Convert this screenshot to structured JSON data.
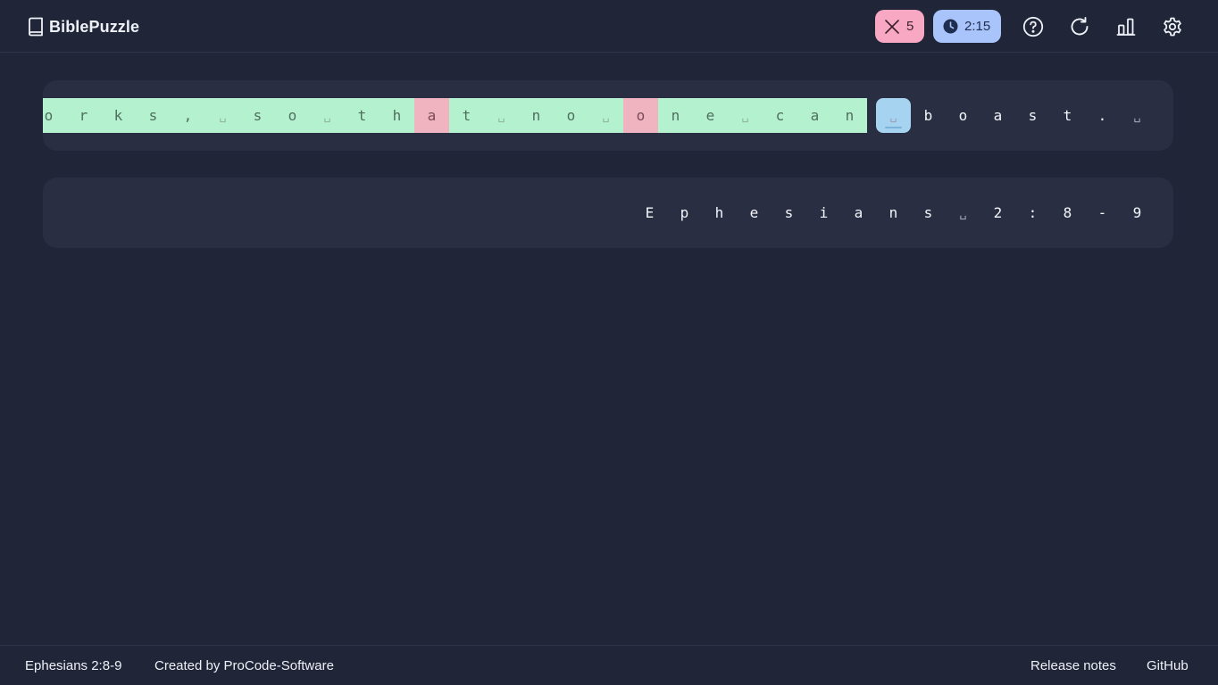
{
  "header": {
    "brand_name": "BiblePuzzle",
    "logo_icon": "book-icon",
    "mistakes": {
      "icon": "close-icon",
      "count": "5",
      "color": "#f9a8c3"
    },
    "timer": {
      "icon": "clock-icon",
      "time": "2:15",
      "color": "#a9c4fb"
    },
    "actions": [
      "help-icon",
      "restart-icon",
      "stats-icon",
      "settings-icon"
    ]
  },
  "verse": {
    "visible_text": "orks, so that no one can boast. ",
    "space_glyph": "␣",
    "chars": [
      {
        "c": "o",
        "state": "correct"
      },
      {
        "c": "r",
        "state": "correct"
      },
      {
        "c": "k",
        "state": "correct"
      },
      {
        "c": "s",
        "state": "correct"
      },
      {
        "c": ",",
        "state": "correct"
      },
      {
        "c": "␣",
        "state": "correct"
      },
      {
        "c": "s",
        "state": "correct"
      },
      {
        "c": "o",
        "state": "correct"
      },
      {
        "c": "␣",
        "state": "correct"
      },
      {
        "c": "t",
        "state": "correct"
      },
      {
        "c": "h",
        "state": "correct"
      },
      {
        "c": "a",
        "state": "wrong"
      },
      {
        "c": "t",
        "state": "correct"
      },
      {
        "c": "␣",
        "state": "correct"
      },
      {
        "c": "n",
        "state": "correct"
      },
      {
        "c": "o",
        "state": "correct"
      },
      {
        "c": "␣",
        "state": "correct"
      },
      {
        "c": "o",
        "state": "wrong"
      },
      {
        "c": "n",
        "state": "correct"
      },
      {
        "c": "e",
        "state": "correct"
      },
      {
        "c": "␣",
        "state": "correct"
      },
      {
        "c": "c",
        "state": "correct"
      },
      {
        "c": "a",
        "state": "correct"
      },
      {
        "c": "n",
        "state": "correct"
      },
      {
        "c": "␣",
        "state": "cursor"
      },
      {
        "c": "b",
        "state": "pending"
      },
      {
        "c": "o",
        "state": "pending"
      },
      {
        "c": "a",
        "state": "pending"
      },
      {
        "c": "s",
        "state": "pending"
      },
      {
        "c": "t",
        "state": "pending"
      },
      {
        "c": ".",
        "state": "pending"
      },
      {
        "c": "␣",
        "state": "pending"
      }
    ]
  },
  "reference": {
    "text": "Ephesians 2:8-9",
    "chars": [
      "E",
      "p",
      "h",
      "e",
      "s",
      "i",
      "a",
      "n",
      "s",
      "␣",
      "2",
      ":",
      "8",
      "-",
      "9"
    ]
  },
  "footer": {
    "reference": "Ephesians 2:8-9",
    "credit": "Created by ProCode-Software",
    "release_notes": "Release notes",
    "github": "GitHub"
  }
}
